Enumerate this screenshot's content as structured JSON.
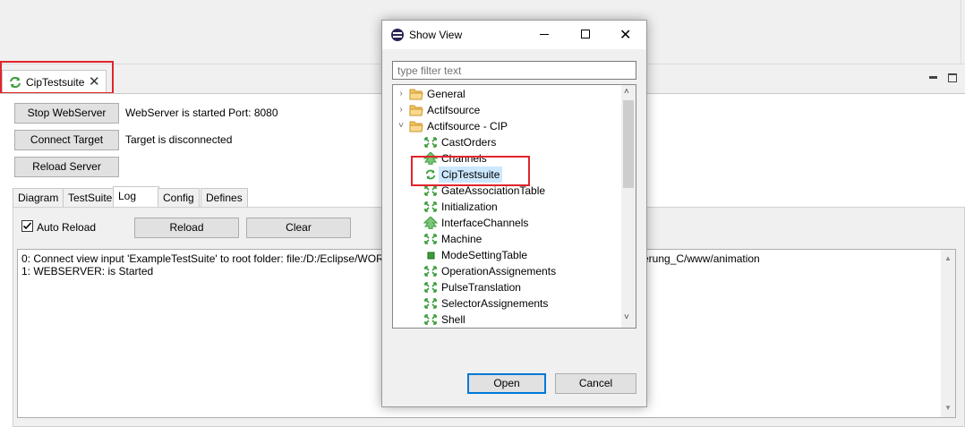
{
  "view_tab": {
    "title": "CipTestsuite"
  },
  "buttons": {
    "stop_webserver": "Stop WebServer",
    "connect_target": "Connect Target",
    "reload_server": "Reload Server",
    "reload": "Reload",
    "clear": "Clear"
  },
  "status": {
    "webserver": "WebServer is started Port: 8080",
    "target": "Target is disconnected"
  },
  "tabs": [
    "Diagram",
    "TestSuite",
    "Log",
    "Config",
    "Defines"
  ],
  "active_tab": "Log",
  "auto_reload": {
    "label": "Auto Reload",
    "checked": true
  },
  "log_lines": [
    "0: Connect view input 'ExampleTestSuite' to root folder: file:/D:/Eclipse/WOR",
    "1: WEBSERVER: is Started"
  ],
  "log_line0_tail": "erung_C/www/animation",
  "dialog": {
    "title": "Show View",
    "filter_placeholder": "type filter text",
    "tree": [
      {
        "label": "General",
        "kind": "folder",
        "expanded": false
      },
      {
        "label": "Actifsource",
        "kind": "folder",
        "expanded": false
      },
      {
        "label": "Actifsource - CIP",
        "kind": "folder",
        "expanded": true
      },
      {
        "label": "CastOrders",
        "kind": "arrows-icon"
      },
      {
        "label": "Channels",
        "kind": "tree-icon"
      },
      {
        "label": "CipTestsuite",
        "kind": "cycle-icon",
        "selected": true
      },
      {
        "label": "GateAssociationTable",
        "kind": "arrows-icon"
      },
      {
        "label": "Initialization",
        "kind": "arrows-icon"
      },
      {
        "label": "InterfaceChannels",
        "kind": "tree-icon"
      },
      {
        "label": "Machine",
        "kind": "arrows-icon"
      },
      {
        "label": "ModeSettingTable",
        "kind": "square-icon"
      },
      {
        "label": "OperationAssignements",
        "kind": "arrows-icon"
      },
      {
        "label": "PulseTranslation",
        "kind": "arrows-icon"
      },
      {
        "label": "SelectorAssignements",
        "kind": "arrows-icon"
      },
      {
        "label": "Shell",
        "kind": "arrows-icon"
      }
    ],
    "open_label": "Open",
    "cancel_label": "Cancel"
  },
  "colors": {
    "highlight_red": "#e0242c",
    "selection": "#cce8ff",
    "focus_blue": "#0078d7",
    "icon_green": "#3a9d3a"
  }
}
